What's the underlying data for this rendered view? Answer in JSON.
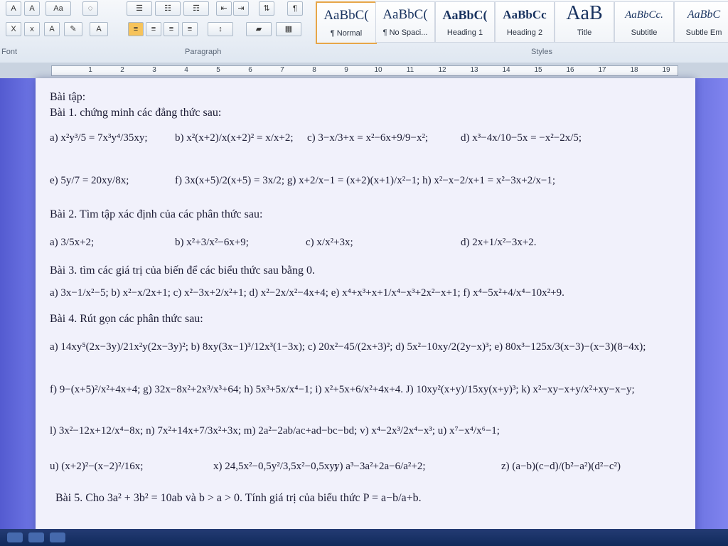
{
  "ribbon": {
    "font_group_label": "Font",
    "paragraph_group_label": "Paragraph",
    "styles_group_label": "Styles",
    "font_tools": [
      "A",
      "A",
      "Aa",
      "X",
      "x"
    ],
    "styles": [
      {
        "sample": "AaBbC(",
        "name": "¶ Normal"
      },
      {
        "sample": "AaBbC(",
        "name": "¶ No Spaci..."
      },
      {
        "sample": "AaBbC(",
        "name": "Heading 1"
      },
      {
        "sample": "AaBbCc",
        "name": "Heading 2"
      },
      {
        "sample": "AaB",
        "name": "Title"
      },
      {
        "sample": "AaBbCc.",
        "name": "Subtitle"
      },
      {
        "sample": "AaBbC",
        "name": "Subtle Em"
      }
    ]
  },
  "ruler": {
    "ticks": [
      "1",
      "2",
      "3",
      "4",
      "5",
      "6",
      "7",
      "8",
      "9",
      "10",
      "11",
      "12",
      "13",
      "14",
      "15",
      "16",
      "17",
      "18",
      "19"
    ]
  },
  "document": {
    "heading": "Bài tập:",
    "bai1_title": "Bài 1. chứng minh các đẳng thức sau:",
    "bai1_row1": {
      "a": "a) x²y³/5 = 7x³y⁴/35xy;",
      "b": "b) x²(x+2)/x(x+2)² = x/x+2;",
      "c": "c) 3−x/3+x = x²−6x+9/9−x²;",
      "d": "d) x³−4x/10−5x = −x²−2x/5;"
    },
    "bai1_row2": {
      "e": "e) 5y/7 = 20xy/8x;",
      "f": "f) 3x(x+5)/2(x+5) = 3x/2; g) x+2/x−1 = (x+2)(x+1)/x²−1; h) x²−x−2/x+1 = x²−3x+2/x−1;"
    },
    "bai2_title": "Bài 2. Tìm tập xác định của các phân thức sau:",
    "bai2_row": {
      "a": "a) 3/5x+2;",
      "b": "b) x²+3/x²−6x+9;",
      "c": "c) x/x²+3x;",
      "d": "d) 2x+1/x²−3x+2."
    },
    "bai3_title": "Bài 3. tìm các giá trị của biến để các biểu thức sau bằng 0.",
    "bai3_row": {
      "a": "a) 3x−1/x²−5;  b) x²−x/2x+1;  c) x²−3x+2/x²+1;  d) x²−2x/x²−4x+4;  e) x⁴+x³+x+1/x⁴−x³+2x²−x+1;  f) x⁴−5x²+4/x⁴−10x²+9."
    },
    "bai4_title": "Bài 4. Rút gọn các phân thức sau:",
    "bai4_row1": {
      "a": "a) 14xy⁵(2x−3y)/21x²y(2x−3y)²;  b) 8xy(3x−1)³/12x³(1−3x);  c) 20x²−45/(2x+3)²;  d) 5x²−10xy/2(2y−x)³;  e) 80x³−125x/3(x−3)−(x−3)(8−4x);"
    },
    "bai4_row2": {
      "f": "f) 9−(x+5)²/x²+4x+4;  g) 32x−8x²+2x³/x³+64;  h) 5x³+5x/x⁴−1;  i) x²+5x+6/x²+4x+4.  J) 10xy²(x+y)/15xy(x+y)³;  k) x²−xy−x+y/x²+xy−x−y;"
    },
    "bai4_row3": {
      "l": "l) 3x²−12x+12/x⁴−8x;  n) 7x²+14x+7/3x²+3x;  m) 2a²−2ab/ac+ad−bc−bd;  v) x⁴−2x³/2x⁴−x³;  u) x⁷−x⁴/x⁶−1;"
    },
    "bai4_row4": {
      "u": "u) (x+2)²−(x−2)²/16x;",
      "x": "x) 24,5x²−0,5y²/3,5x²−0,5xy;",
      "y": "y) a³−3a²+2a−6/a²+2;",
      "z": "z) (a−b)(c−d)/(b²−a²)(d²−c²)"
    },
    "bai5": "Bài 5. Cho 3a² + 3b² = 10ab và b > a > 0. Tính giá trị của biểu thức P = a−b/a+b."
  },
  "colors": {
    "ribbon_bg": "#e7edf4",
    "page_bg": "#f1f1fb",
    "text": "#1b1b34",
    "selected_style_border": "#e7a648"
  }
}
